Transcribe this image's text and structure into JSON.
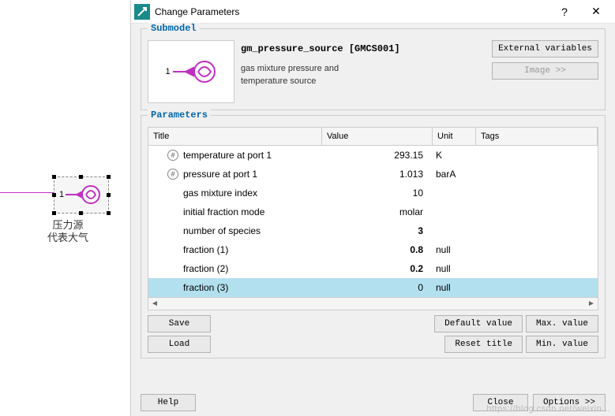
{
  "left": {
    "port_number": "1",
    "label_line1": "压力源",
    "label_line2": "代表大气"
  },
  "dialog": {
    "title": "Change Parameters",
    "help_symbol": "?",
    "close_symbol": "✕"
  },
  "submodel": {
    "group_title": "Submodel",
    "port_number": "1",
    "name": "gm_pressure_source [GMCS001]",
    "description_line1": "gas mixture pressure and",
    "description_line2": "temperature source",
    "btn_ext_vars": "External variables",
    "btn_image": "Image >>"
  },
  "parameters": {
    "group_title": "Parameters",
    "headers": {
      "title": "Title",
      "value": "Value",
      "unit": "Unit",
      "tags": "Tags"
    },
    "rows": [
      {
        "hash": true,
        "title": "temperature at port 1",
        "value": "293.15",
        "bold": false,
        "unit": "K",
        "selected": false
      },
      {
        "hash": true,
        "title": "pressure at port 1",
        "value": "1.013",
        "bold": false,
        "unit": "barA",
        "selected": false
      },
      {
        "hash": false,
        "title": "gas mixture index",
        "value": "10",
        "bold": false,
        "unit": "",
        "selected": false
      },
      {
        "hash": false,
        "title": "initial fraction mode",
        "value": "molar",
        "bold": false,
        "unit": "",
        "selected": false
      },
      {
        "hash": false,
        "title": "number of species",
        "value": "3",
        "bold": true,
        "unit": "",
        "selected": false
      },
      {
        "hash": false,
        "title": "fraction (1)",
        "value": "0.8",
        "bold": true,
        "unit": "null",
        "selected": false
      },
      {
        "hash": false,
        "title": "fraction (2)",
        "value": "0.2",
        "bold": true,
        "unit": "null",
        "selected": false
      },
      {
        "hash": false,
        "title": "fraction (3)",
        "value": "0",
        "bold": false,
        "unit": "null",
        "selected": true
      }
    ],
    "btn_save": "Save",
    "btn_load": "Load",
    "btn_default": "Default value",
    "btn_max": "Max. value",
    "btn_reset": "Reset title",
    "btn_min": "Min. value"
  },
  "footer": {
    "help": "Help",
    "close": "Close",
    "options": "Options >>"
  },
  "watermark": "https://blog.csdn.net/weixin..."
}
